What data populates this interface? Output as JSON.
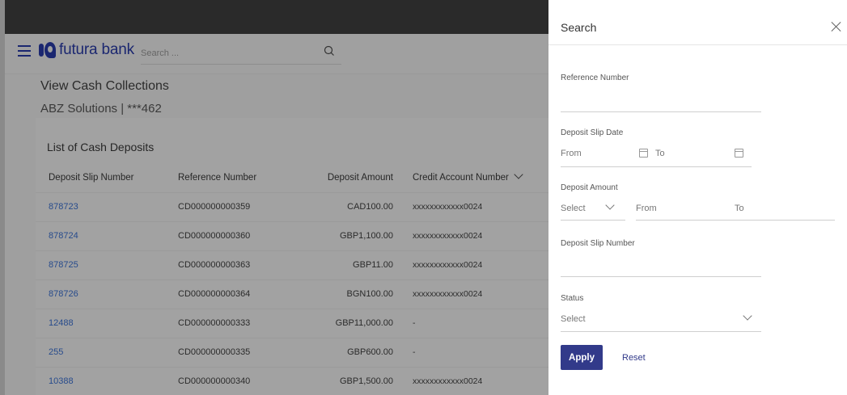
{
  "app": {
    "brand": "futura bank",
    "search": {
      "placeholder": "Search ...",
      "value": ""
    }
  },
  "page": {
    "title": "View Cash Collections",
    "subtitle": "ABZ Solutions | ***462",
    "list_title": "List of Cash Deposits",
    "columns": [
      "Deposit Slip Number",
      "Reference Number",
      "Deposit Amount",
      "Credit Account Number"
    ],
    "rows": [
      {
        "slip": "878723",
        "ref": "CD000000000359",
        "amount": "CAD100.00",
        "account": "xxxxxxxxxxxx0024"
      },
      {
        "slip": "878724",
        "ref": "CD000000000360",
        "amount": "GBP1,100.00",
        "account": "xxxxxxxxxxxx0024"
      },
      {
        "slip": "878725",
        "ref": "CD000000000363",
        "amount": "GBP11.00",
        "account": "xxxxxxxxxxxx0024"
      },
      {
        "slip": "878726",
        "ref": "CD000000000364",
        "amount": "BGN100.00",
        "account": "xxxxxxxxxxxx0024"
      },
      {
        "slip": "12488",
        "ref": "CD000000000333",
        "amount": "GBP11,000.00",
        "account": "-"
      },
      {
        "slip": "255",
        "ref": "CD000000000335",
        "amount": "GBP600.00",
        "account": "-"
      },
      {
        "slip": "10388",
        "ref": "CD000000000340",
        "amount": "GBP1,500.00",
        "account": "xxxxxxxxxxxx0024"
      }
    ]
  },
  "panel": {
    "title": "Search",
    "reference_number_label": "Reference Number",
    "deposit_slip_date_label": "Deposit Slip Date",
    "from_label": "From",
    "to_label": "To",
    "deposit_amount_label": "Deposit Amount",
    "amount_select": "Select",
    "amount_from": "From",
    "amount_to": "To",
    "deposit_slip_number_label": "Deposit Slip Number",
    "status_label": "Status",
    "status_select": "Select",
    "apply_label": "Apply",
    "reset_label": "Reset"
  },
  "colors": {
    "brand": "#1b2770",
    "primary_button": "#323a8a",
    "link": "#274b8c"
  }
}
